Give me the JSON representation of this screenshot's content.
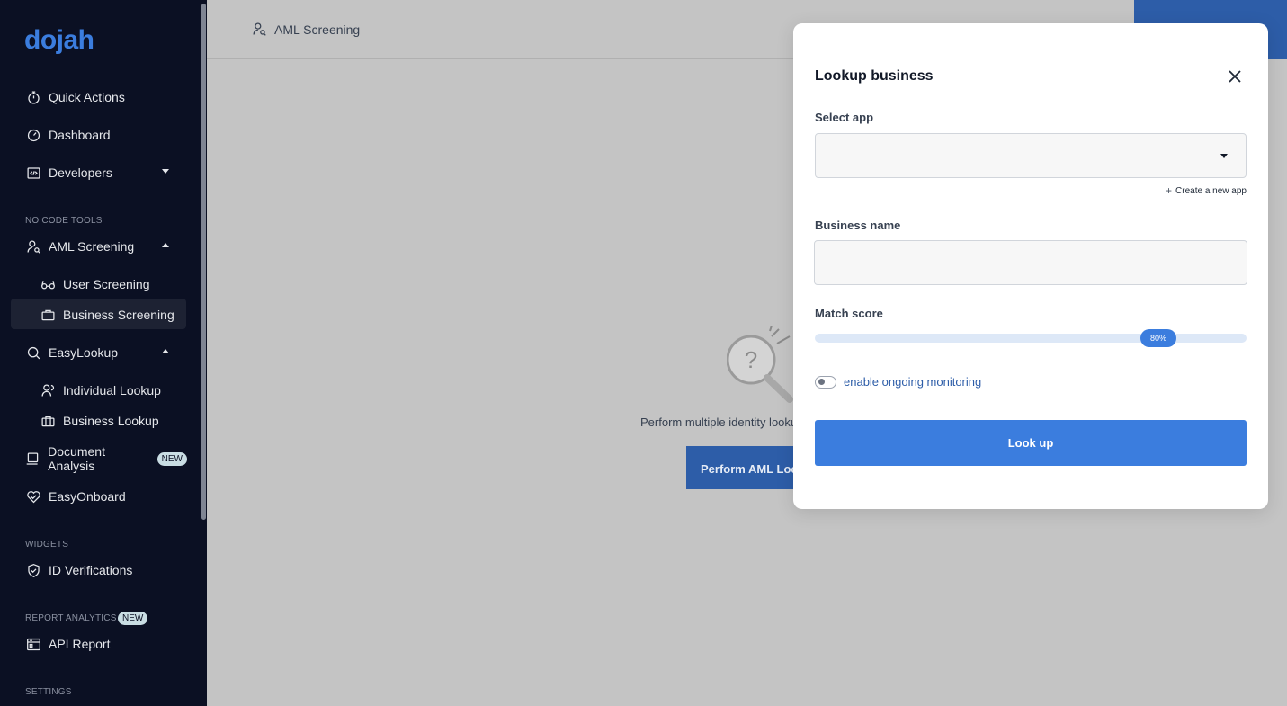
{
  "brand": {
    "logo_text": "dojah",
    "accent": "#3b7dde"
  },
  "sidebar": {
    "quick_actions": "Quick Actions",
    "dashboard": "Dashboard",
    "developers": "Developers",
    "no_code_tools_label": "NO CODE TOOLS",
    "aml_screening": "AML Screening",
    "user_screening": "User Screening",
    "business_screening": "Business Screening",
    "easylookup": "EasyLookup",
    "individual_lookup": "Individual Lookup",
    "business_lookup": "Business Lookup",
    "document_analysis": "Document Analysis",
    "new_badge": "NEW",
    "easyonboard": "EasyOnboard",
    "widgets_label": "WIDGETS",
    "id_verifications": "ID Verifications",
    "report_analytics_label": "REPORT ANALYTICS",
    "api_report": "API Report",
    "settings_label": "SETTINGS"
  },
  "header": {
    "title": "AML Screening"
  },
  "empty_state": {
    "text": "Perform multiple identity lookups",
    "button_label": "Perform AML Lookup"
  },
  "modal": {
    "title": "Lookup business",
    "select_app_label": "Select app",
    "select_app_value": "",
    "create_app_link": "Create a new app",
    "business_name_label": "Business name",
    "business_name_value": "",
    "business_name_placeholder": "",
    "match_score_label": "Match score",
    "match_score_value": 0.8,
    "match_score_display": "80%",
    "monitoring_label": "enable ongoing monitoring",
    "monitoring_enabled": false,
    "submit_label": "Look up"
  }
}
